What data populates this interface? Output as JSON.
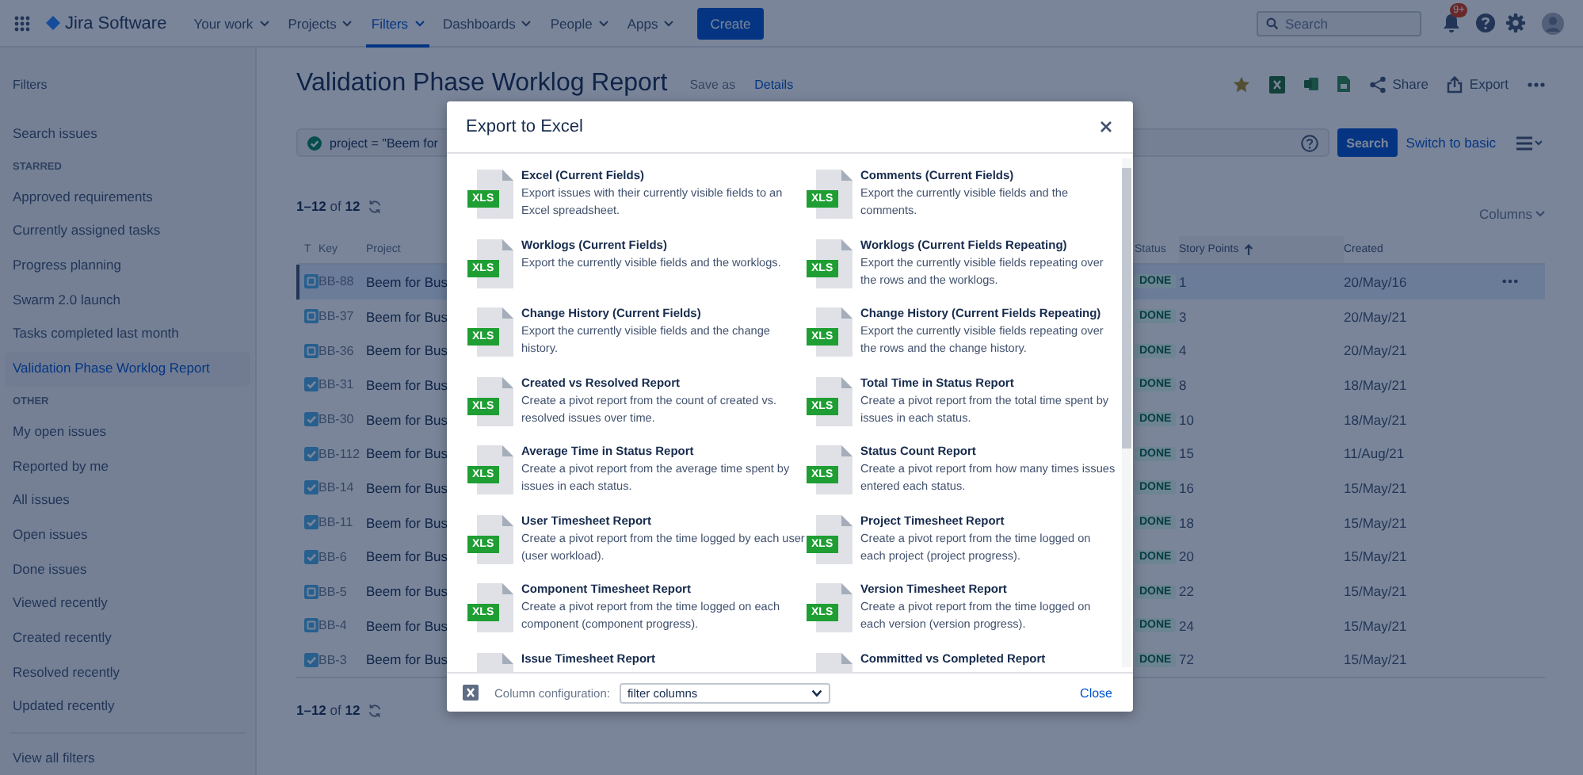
{
  "nav": {
    "logo": "Jira Software",
    "items": [
      {
        "label": "Your work",
        "selected": false
      },
      {
        "label": "Projects",
        "selected": false
      },
      {
        "label": "Filters",
        "selected": true
      },
      {
        "label": "Dashboards",
        "selected": false
      },
      {
        "label": "People",
        "selected": false
      },
      {
        "label": "Apps",
        "selected": false
      }
    ],
    "create": "Create",
    "search_placeholder": "Search",
    "notification_badge": "9+"
  },
  "sidebar": {
    "title": "Filters",
    "items": [
      {
        "kind": "item",
        "label": "Search issues",
        "selected": false
      },
      {
        "kind": "section",
        "label": "STARRED"
      },
      {
        "kind": "item",
        "label": "Approved requirements",
        "selected": false
      },
      {
        "kind": "item",
        "label": "Currently assigned tasks",
        "selected": false
      },
      {
        "kind": "item",
        "label": "Progress planning",
        "selected": false
      },
      {
        "kind": "item",
        "label": "Swarm 2.0 launch",
        "selected": false
      },
      {
        "kind": "item",
        "label": "Tasks completed last month",
        "selected": false
      },
      {
        "kind": "item",
        "label": "Validation Phase Worklog Report",
        "selected": true
      },
      {
        "kind": "section",
        "label": "OTHER"
      },
      {
        "kind": "item",
        "label": "My open issues",
        "selected": false
      },
      {
        "kind": "item",
        "label": "Reported by me",
        "selected": false
      },
      {
        "kind": "item",
        "label": "All issues",
        "selected": false
      },
      {
        "kind": "item",
        "label": "Open issues",
        "selected": false
      },
      {
        "kind": "item",
        "label": "Done issues",
        "selected": false
      },
      {
        "kind": "item",
        "label": "Viewed recently",
        "selected": false
      },
      {
        "kind": "item",
        "label": "Created recently",
        "selected": false
      },
      {
        "kind": "item",
        "label": "Resolved recently",
        "selected": false
      },
      {
        "kind": "item",
        "label": "Updated recently",
        "selected": false
      }
    ],
    "footer": "View all filters"
  },
  "page": {
    "title": "Validation Phase Worklog Report",
    "links": [
      "Save as",
      "Details"
    ],
    "actions": [
      {
        "kind": "star"
      },
      {
        "kind": "excel"
      },
      {
        "kind": "sheet"
      },
      {
        "kind": "doc"
      },
      {
        "kind": "share",
        "label": "Share"
      },
      {
        "kind": "export",
        "label": "Export"
      },
      {
        "kind": "more"
      }
    ],
    "query": "project = \"Beem for",
    "search_button": "Search",
    "switch_link": "Switch to basic",
    "count_top": "**1–12** of **12**",
    "count_bottom": "**1–12** of **12**",
    "columns_button": "Columns"
  },
  "table": {
    "columns": [
      {
        "label": "T",
        "sorted": false
      },
      {
        "label": "Key",
        "sorted": false
      },
      {
        "label": "Project",
        "sorted": false
      },
      {
        "label": "Status",
        "sorted": false
      },
      {
        "label": "Story Points",
        "sorted": true
      },
      {
        "label": "Created",
        "sorted": false
      }
    ],
    "rows": [
      {
        "kind": "story",
        "key": "BB-88",
        "project": "Beem for Bus",
        "status": "DONE",
        "points": "1",
        "created": "20/May/16",
        "selected": true
      },
      {
        "kind": "story",
        "key": "BB-37",
        "project": "Beem for Bus",
        "status": "DONE",
        "points": "3",
        "created": "20/May/21",
        "selected": false
      },
      {
        "kind": "story",
        "key": "BB-36",
        "project": "Beem for Bus",
        "status": "DONE",
        "points": "4",
        "created": "20/May/21",
        "selected": false
      },
      {
        "kind": "task",
        "key": "BB-31",
        "project": "Beem for Bus",
        "status": "DONE",
        "points": "8",
        "created": "18/May/21",
        "selected": false
      },
      {
        "kind": "task",
        "key": "BB-30",
        "project": "Beem for Bus",
        "status": "DONE",
        "points": "10",
        "created": "18/May/21",
        "selected": false
      },
      {
        "kind": "task",
        "key": "BB-112",
        "project": "Beem for Bus",
        "status": "DONE",
        "points": "15",
        "created": "11/Aug/21",
        "selected": false
      },
      {
        "kind": "task",
        "key": "BB-14",
        "project": "Beem for Bus",
        "status": "DONE",
        "points": "16",
        "created": "15/May/21",
        "selected": false
      },
      {
        "kind": "task",
        "key": "BB-11",
        "project": "Beem for Bus",
        "status": "DONE",
        "points": "18",
        "created": "15/May/21",
        "selected": false
      },
      {
        "kind": "task",
        "key": "BB-6",
        "project": "Beem for Bus",
        "status": "DONE",
        "points": "20",
        "created": "15/May/21",
        "selected": false
      },
      {
        "kind": "story",
        "key": "BB-5",
        "project": "Beem for Bus",
        "status": "DONE",
        "points": "22",
        "created": "15/May/21",
        "selected": false
      },
      {
        "kind": "story",
        "key": "BB-4",
        "project": "Beem for Bus",
        "status": "DONE",
        "points": "24",
        "created": "15/May/21",
        "selected": false
      },
      {
        "kind": "task",
        "key": "BB-3",
        "project": "Beem for Bus",
        "status": "DONE",
        "points": "72",
        "created": "15/May/21",
        "selected": false
      }
    ]
  },
  "modal": {
    "title": "Export to Excel",
    "items": [
      {
        "badge": "XLS",
        "title": "Excel (Current Fields)",
        "description": "Export issues with their currently visible fields to an Excel spreadsheet."
      },
      {
        "badge": "XLS",
        "title": "Comments (Current Fields)",
        "description": "Export the currently visible fields and the comments."
      },
      {
        "badge": "XLS",
        "title": "Worklogs (Current Fields)",
        "description": "Export the currently visible fields and the worklogs."
      },
      {
        "badge": "XLS",
        "title": "Worklogs (Current Fields Repeating)",
        "description": "Export the currently visible fields repeating over the rows and the worklogs."
      },
      {
        "badge": "XLS",
        "title": "Change History (Current Fields)",
        "description": "Export the currently visible fields and the change history."
      },
      {
        "badge": "XLS",
        "title": "Change History (Current Fields Repeating)",
        "description": "Export the currently visible fields repeating over the rows and the change history."
      },
      {
        "badge": "XLS",
        "title": "Created vs Resolved Report",
        "description": "Create a pivot report from the count of created vs. resolved issues over time."
      },
      {
        "badge": "XLS",
        "title": "Total Time in Status Report",
        "description": "Create a pivot report from the total time spent by issues in each status."
      },
      {
        "badge": "XLS",
        "title": "Average Time in Status Report",
        "description": "Create a pivot report from the average time spent by issues in each status."
      },
      {
        "badge": "XLS",
        "title": "Status Count Report",
        "description": "Create a pivot report from how many times issues entered each status."
      },
      {
        "badge": "XLS",
        "title": "User Timesheet Report",
        "description": "Create a pivot report from the time logged by each user (user workload)."
      },
      {
        "badge": "XLS",
        "title": "Project Timesheet Report",
        "description": "Create a pivot report from the time logged on each project (project progress)."
      },
      {
        "badge": "XLS",
        "title": "Component Timesheet Report",
        "description": "Create a pivot report from the time logged on each component (component progress)."
      },
      {
        "badge": "XLS",
        "title": "Version Timesheet Report",
        "description": "Create a pivot report from the time logged on each version (version progress)."
      },
      {
        "title": "Issue Timesheet Report"
      },
      {
        "title": "Committed vs Completed Report"
      }
    ],
    "column_label": "Column configuration:",
    "column_select": "filter columns",
    "close": "Close"
  }
}
